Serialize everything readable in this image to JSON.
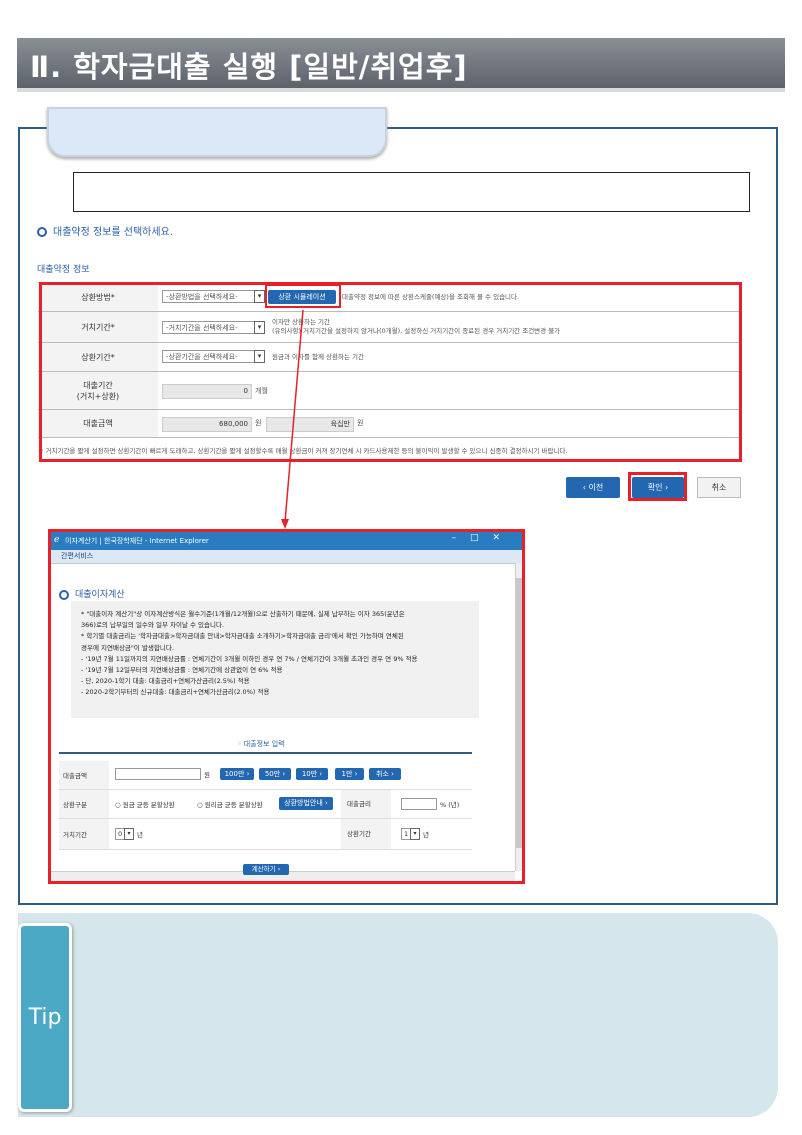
{
  "header": {
    "title": "Ⅱ. 학자금대출 실행 [일반/취업후]"
  },
  "instruction": "대출약정 정보를 선택하세요.",
  "form": {
    "section_label": "대출약정 정보",
    "rows": [
      {
        "label": "상환방법*",
        "select": "-상환방법을 선택하세요-",
        "button": "상환 시뮬레이션",
        "hint": "대출약정 정보에 따른 상환스케줄(예상)을 조회해 볼 수 있습니다."
      },
      {
        "label": "거치기간*",
        "select": "-거치기간을 선택하세요-",
        "hint1": "이자만 상환하는 기간",
        "hint2": "(유의사항) 거치기간을 설정하지 않거나(0개월), 설정하신 거치기간이 종료된 경우 거치기간 조건변경 불가"
      },
      {
        "label": "상환기간*",
        "select": "-상환기간을 선택하세요-",
        "hint": "원금과 이자를 함께 상환하는 기간"
      },
      {
        "label_line1": "대출기간",
        "label_line2": "(거치+상환)",
        "value": "0",
        "unit": "개월"
      },
      {
        "label": "대출금액",
        "value": "680,000",
        "unit": "원",
        "korean_value": "육십만",
        "korean_unit": "원"
      }
    ],
    "note": "※ 거치기간을 짧게 설정하면 상환기간이 빠르게 도래하고, 상환기간을 짧게 설정할수록 매월 상환금이 커져 장기연체 시 카드사용제한 등의 불이익이 발생할 수 있으니 신중히 결정하시기 바랍니다."
  },
  "buttons": {
    "prev": "‹ 이전",
    "confirm": "확인 ›",
    "cancel": "취소"
  },
  "popup": {
    "window_title": "이자계산기 | 한국장학재단 - Internet Explorer",
    "menu": "간편서비스",
    "heading": "대출이자계산",
    "notes": [
      "* \"대출이자 계산기\"상 이자계산방식은 월수기준(1개월/12개월)으로 산출하기 때문에, 실제 납부하는 이자 365(윤년은",
      "  366)로의 납부일의 일수와 일부 차이날 수 있습니다.",
      "* 학기별 대출금리는 '학자금대출>학자금대출 안내>학자금대출 소개하기>학자금대출 금리'에서 확인 가능하며 연체된",
      "  경우에 지연배상금\"이 발생합니다.",
      "- '19년 7월 11일까지의 지연배상금률 : 연체기간이 3개월 이하인 경우 연 7% / 연체기간이 3개월 초과인 경우 연 9% 적용",
      "- '19년 7월 12일부터의 지연배상금률 : 연체기간에 상관없이 연 6% 적용",
      "- 단, 2020-1학기 대출: 대출금리+연체가산금리(2.5%) 적용",
      "- 2020-2학기부터의 신규대출: 대출금리+연체가산금리(2.0%) 적용"
    ],
    "input_title": "◦ 대출정보 입력",
    "amount_label": "대출금액",
    "amount_unit": "원",
    "amount_buttons": [
      "100만 ›",
      "50만 ›",
      "10만 ›",
      "1만 ›",
      "취소 ›"
    ],
    "repay_label": "상환구분",
    "repay_opt1": "○ 원금 균등 분할상환",
    "repay_opt2": "○ 원리금 균등 분할상환",
    "repay_guide": "상환방법안내 ›",
    "rate_label": "대출금리",
    "rate_unit": "% (년)",
    "defer_label": "거치기간",
    "defer_value": "0",
    "defer_unit": "년",
    "term_label": "상환기간",
    "term_value": "1",
    "term_unit": "년",
    "calc_button": "계산하기 ›"
  },
  "tip": {
    "label": "Tip"
  },
  "colors": {
    "accent_blue": "#2367b0",
    "highlight_red": "#e8202a",
    "frame_blue": "#2f5d82",
    "tip_bg": "#d5e6ec",
    "tip_badge": "#4ba9c6"
  }
}
